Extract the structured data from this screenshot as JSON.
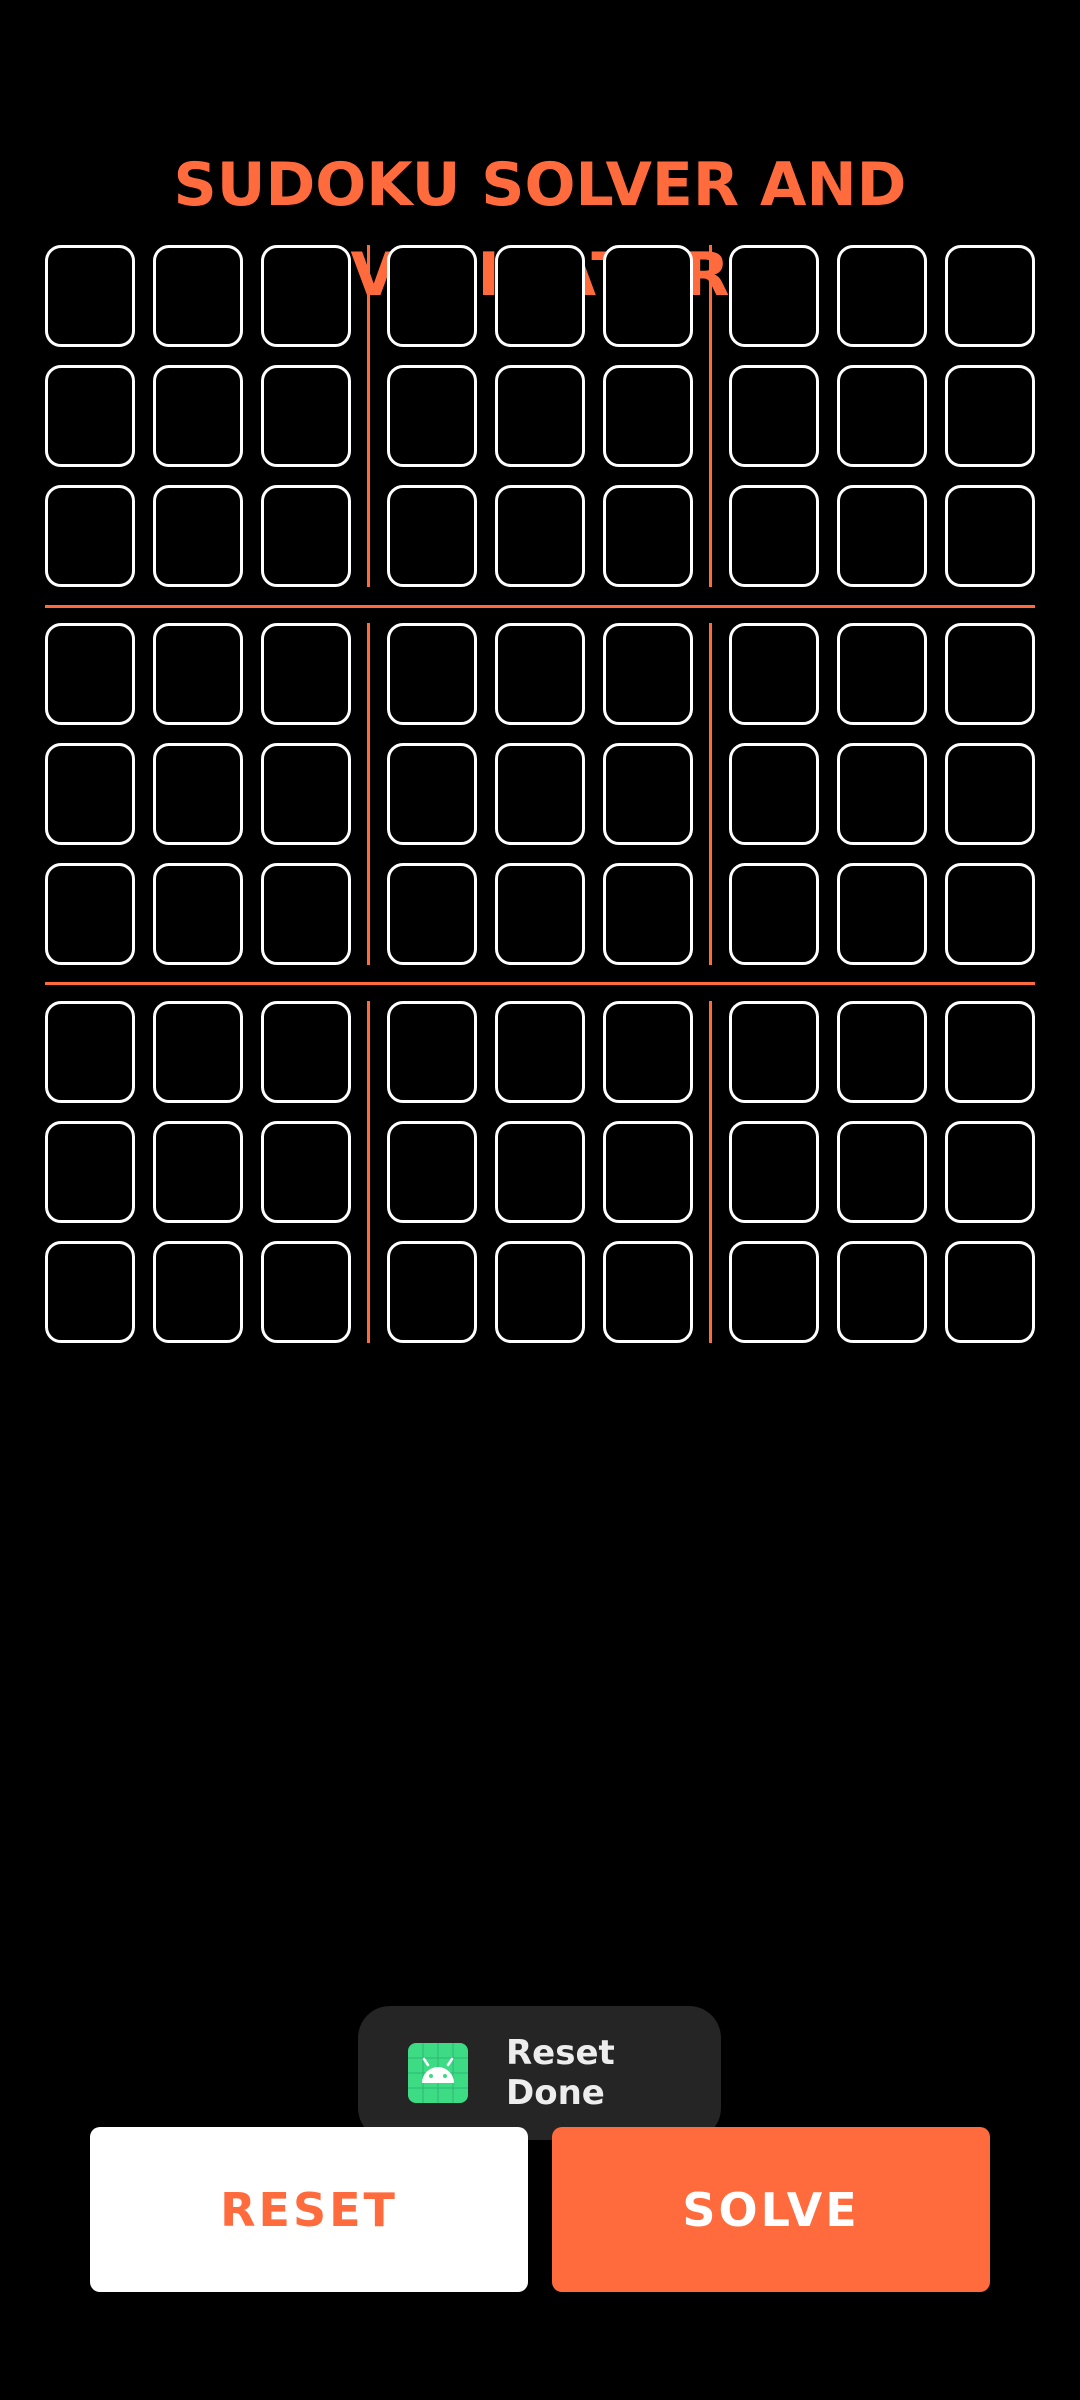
{
  "app": {
    "title": "SUDOKU SOLVER AND VALIDATOR"
  },
  "board": {
    "rows": 9,
    "cols": 9,
    "cells": [
      [
        "",
        "",
        "",
        "",
        "",
        "",
        "",
        "",
        ""
      ],
      [
        "",
        "",
        "",
        "",
        "",
        "",
        "",
        "",
        ""
      ],
      [
        "",
        "",
        "",
        "",
        "",
        "",
        "",
        "",
        ""
      ],
      [
        "",
        "",
        "",
        "",
        "",
        "",
        "",
        "",
        ""
      ],
      [
        "",
        "",
        "",
        "",
        "",
        "",
        "",
        "",
        ""
      ],
      [
        "",
        "",
        "",
        "",
        "",
        "",
        "",
        "",
        ""
      ],
      [
        "",
        "",
        "",
        "",
        "",
        "",
        "",
        "",
        ""
      ],
      [
        "",
        "",
        "",
        "",
        "",
        "",
        "",
        "",
        ""
      ],
      [
        "",
        "",
        "",
        "",
        "",
        "",
        "",
        "",
        ""
      ]
    ]
  },
  "toast": {
    "icon": "android-icon",
    "message": "Reset Done"
  },
  "actions": {
    "reset_label": "RESET",
    "solve_label": "SOLVE"
  },
  "colors": {
    "accent": "#FF6B3D",
    "background": "#000000",
    "cell_border": "#FFFFFF",
    "toast_bg": "#252525"
  }
}
